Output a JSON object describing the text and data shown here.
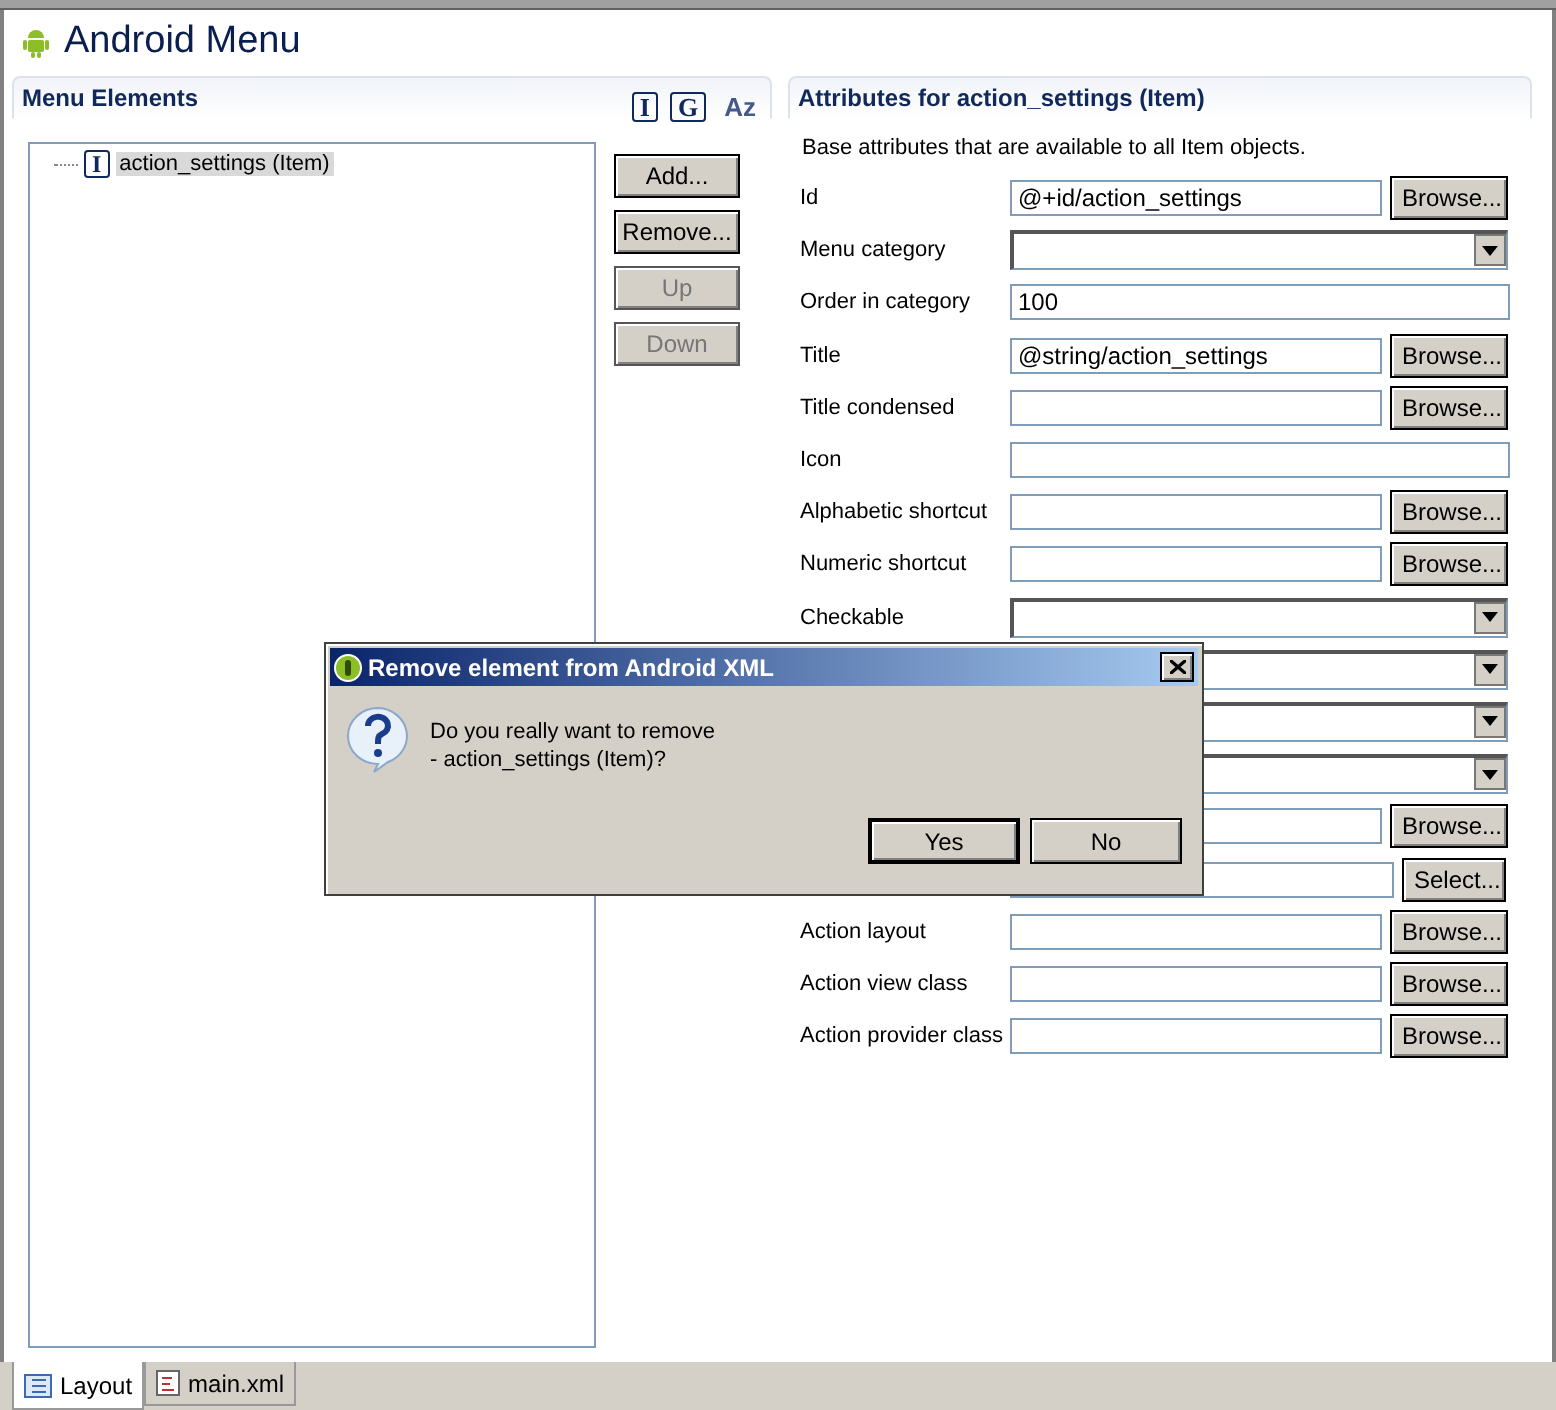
{
  "editor": {
    "title": "Android Menu"
  },
  "menu_elements": {
    "title": "Menu Elements",
    "toolbar": [
      "I",
      "G",
      "Az"
    ],
    "tree": [
      {
        "icon": "I",
        "label": "action_settings (Item)",
        "selected": true
      }
    ],
    "buttons": [
      {
        "label": "Add...",
        "disabled": false
      },
      {
        "label": "Remove...",
        "disabled": false
      },
      {
        "label": "Up",
        "disabled": true
      },
      {
        "label": "Down",
        "disabled": true
      }
    ]
  },
  "attributes": {
    "title": "Attributes for action_settings (Item)",
    "description": "Base attributes that are available to all Item objects.",
    "rows": [
      {
        "kind": "text",
        "label": "Id",
        "value": "@+id/action_settings",
        "button": "Browse..."
      },
      {
        "kind": "combo",
        "label": "Menu category"
      },
      {
        "kind": "text",
        "label": "Order in category",
        "value": "100"
      },
      {
        "kind": "text",
        "label": "Title",
        "value": "@string/action_settings",
        "button": "Browse..."
      },
      {
        "kind": "text",
        "label": "Title condensed",
        "button": "Browse..."
      },
      {
        "kind": "text",
        "label": "Icon"
      },
      {
        "kind": "text",
        "label": "Alphabetic shortcut",
        "button": "Browse..."
      },
      {
        "kind": "text",
        "label": "Numeric shortcut",
        "button": "Browse..."
      },
      {
        "kind": "combo",
        "label": "Checkable"
      },
      {
        "kind": "combo"
      },
      {
        "kind": "combo"
      },
      {
        "kind": "combo"
      },
      {
        "kind": "text",
        "button": "Browse..."
      },
      {
        "kind": "text",
        "button": "Select..."
      },
      {
        "kind": "text",
        "label": "Action layout",
        "button": "Browse..."
      },
      {
        "kind": "text",
        "label": "Action view class",
        "button": "Browse..."
      },
      {
        "kind": "text",
        "label": "Action provider class",
        "button": "Browse..."
      }
    ]
  },
  "dialog": {
    "title": "Remove element from Android XML",
    "message": [
      "Do you really want to remove",
      "- action_settings (Item)?"
    ],
    "buttons": [
      {
        "label": "Yes",
        "default": true
      },
      {
        "label": "No",
        "default": false
      }
    ]
  },
  "bottom_tabs": [
    {
      "label": "Layout",
      "selected": true
    },
    {
      "label": "main.xml",
      "selected": false
    }
  ]
}
